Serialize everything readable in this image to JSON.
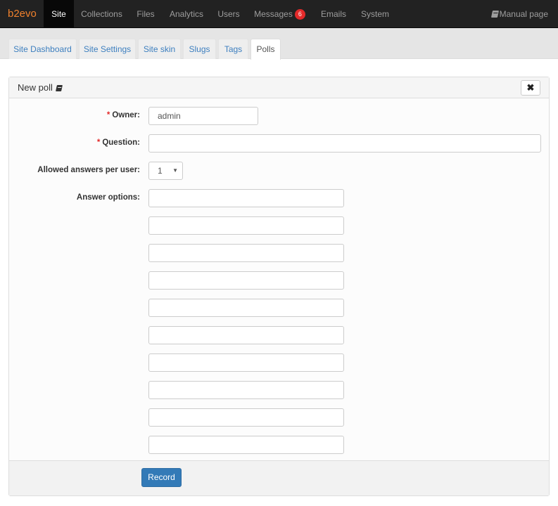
{
  "navbar": {
    "brand": "b2evo",
    "items": [
      {
        "label": "Site",
        "active": true
      },
      {
        "label": "Collections"
      },
      {
        "label": "Files"
      },
      {
        "label": "Analytics"
      },
      {
        "label": "Users"
      },
      {
        "label": "Messages",
        "badge": "6"
      },
      {
        "label": "Emails"
      },
      {
        "label": "System"
      }
    ],
    "manual_label": "Manual page"
  },
  "tabs": [
    {
      "label": "Site Dashboard"
    },
    {
      "label": "Site Settings"
    },
    {
      "label": "Site skin"
    },
    {
      "label": "Slugs"
    },
    {
      "label": "Tags"
    },
    {
      "label": "Polls",
      "active": true
    }
  ],
  "panel": {
    "title": "New poll",
    "close_label": "✖",
    "required_marker": "*",
    "fields": {
      "owner": {
        "label": "Owner:",
        "value": "admin"
      },
      "question": {
        "label": "Question:",
        "value": ""
      },
      "allowed_answers": {
        "label": "Allowed answers per user:",
        "value": "1"
      },
      "answer_options": {
        "label": "Answer options:",
        "values": [
          "",
          "",
          "",
          "",
          "",
          "",
          "",
          "",
          "",
          ""
        ]
      }
    },
    "record_label": "Record"
  },
  "colors": {
    "brand": "#f0812d",
    "navbar_bg": "#222222",
    "link": "#3d7fbf",
    "primary_button": "#337ab7",
    "required": "#e32a2a",
    "badge": "#e32a2a"
  }
}
